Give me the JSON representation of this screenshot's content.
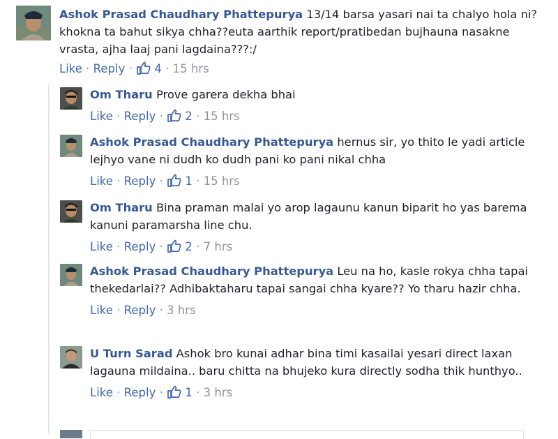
{
  "actions": {
    "like": "Like",
    "reply": "Reply",
    "dot": "·"
  },
  "top_comment": {
    "author": "Ashok Prasad Chaudhary Phattepurya",
    "text": "13/14 barsa yasari nai ta chalyo hola ni?khokna ta bahut sikya chha??euta aarthik report/pratibedan bujhauna nasakne vrasta, ajha laaj pani lagdaina???:/",
    "likes": "4",
    "time": "15 hrs"
  },
  "replies": [
    {
      "author": "Om Tharu",
      "text": "Prove garera dekha bhai",
      "likes": "2",
      "time": "15 hrs",
      "avatar": "om"
    },
    {
      "author": "Ashok Prasad Chaudhary Phattepurya",
      "text": "hernus sir, yo thito le yadi article lejhyo vane ni dudh ko dudh pani ko pani nikal chha",
      "likes": "1",
      "time": "15 hrs",
      "avatar": "ashok"
    },
    {
      "author": "Om Tharu",
      "text": "Bina praman malai yo arop lagaunu kanun biparit ho yas barema kanuni paramarsha line chu.",
      "likes": "2",
      "time": "7 hrs",
      "avatar": "om"
    },
    {
      "author": "Ashok Prasad Chaudhary Phattepurya",
      "text": "Leu na ho, kasle rokya chha tapai thekedarlai?? Adhibaktaharu tapai sangai chha kyare?? Yo tharu hazir chha.",
      "likes": "",
      "time": "3 hrs",
      "avatar": "ashok"
    },
    {
      "author": "U Turn Sarad",
      "text": "Ashok bro kunai adhar bina timi kasailai yesari direct laxan lagauna mildaina.. baru chitta na bhujeko kura directly sodha thik hunthyo..",
      "likes": "1",
      "time": "3 hrs",
      "avatar": "uturn"
    }
  ],
  "colors": {
    "link": "#365899",
    "action": "#4267b2",
    "muted": "#90949c",
    "text": "#1d2129"
  }
}
